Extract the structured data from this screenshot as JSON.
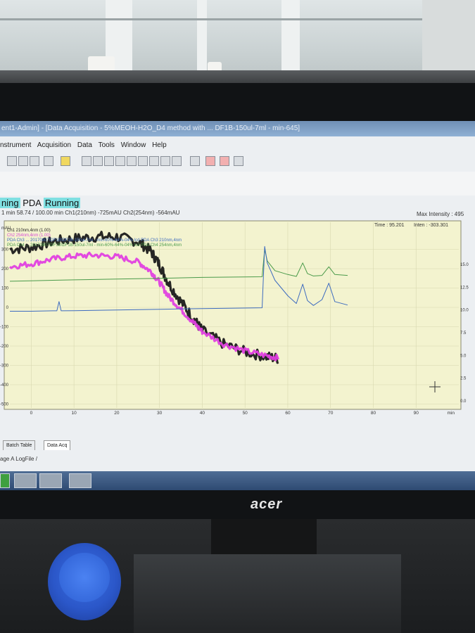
{
  "window": {
    "title": "ent1-Admin] - [Data Acquisition - 5%MEOH-H2O_D4 method with ... DF1B-150ul-7ml - min-645]"
  },
  "menu": [
    "nstrument",
    "Acquisition",
    "Data",
    "Tools",
    "Window",
    "Help"
  ],
  "status": {
    "prefix": "ning",
    "pda_label": "PDA",
    "running_label": "Running"
  },
  "info_line": "1 min 58.74 / 100.00 min Ch1(210nm) -725mAU Ch2(254nm) -564mAU",
  "max_intensity": "Max Intensity :    495",
  "time_readout": "Time : 95.201",
  "inten_readout": "Inten :    -303.301",
  "legend": [
    {
      "text": "Ch1 210nm,4nm (1.00)",
      "color": "#222222"
    },
    {
      "text": "Ch2 254nm,4nm (1.00)",
      "color": "#d94ad9"
    },
    {
      "text": "PDA Ch3 ... 20170807\\DF1B\\DF1B-150ul-7ml - min-60%-64%-04% lcd PDA Ch3 210nm,4nm",
      "color": "#3d6bbf"
    },
    {
      "text": "PDA Ch4 ... 20170807\\DF1B\\DF1B-150ul-7ml - min-60%-64%-04% lcd PDA Ch4 254nm,4nm",
      "color": "#4a9a4a"
    }
  ],
  "tabs": [
    "Batch Table",
    "Data Acq"
  ],
  "bottom_line": "age A LogFile /",
  "monitor_brand": "acer",
  "chart_data": {
    "type": "line",
    "xlabel": "min",
    "ylabel": "mAU",
    "x_ticks": [
      0,
      10,
      20,
      30,
      40,
      50,
      60,
      70,
      80,
      90
    ],
    "y_ticks": [
      -500,
      -400,
      -300,
      -200,
      -100,
      0,
      100,
      200,
      300
    ],
    "right_ticks": [
      "0.0",
      "2.5",
      "5.0",
      "7.5",
      "10.0",
      "12.5",
      "15.0"
    ],
    "xlim": [
      -5,
      100
    ],
    "ylim": [
      -520,
      440
    ],
    "series": [
      {
        "color": "#1a1a1a",
        "x": [
          -5,
          0,
          5,
          10,
          15,
          20,
          25,
          28,
          30,
          32,
          35,
          38,
          40,
          45,
          50,
          55,
          58
        ],
        "y": [
          300,
          310,
          340,
          355,
          365,
          365,
          340,
          290,
          220,
          130,
          30,
          -60,
          -120,
          -190,
          -230,
          -255,
          -265
        ]
      },
      {
        "color": "#e040e0",
        "x": [
          -5,
          0,
          5,
          10,
          15,
          20,
          25,
          28,
          30,
          32,
          35,
          38,
          40,
          45,
          50,
          55,
          58
        ],
        "y": [
          210,
          225,
          250,
          265,
          270,
          262,
          235,
          185,
          130,
          60,
          -10,
          -80,
          -125,
          -190,
          -225,
          -250,
          -262
        ]
      },
      {
        "color": "#4a9a4a",
        "x": [
          -5,
          0,
          5,
          10,
          20,
          30,
          40,
          54,
          54.6,
          55.2,
          57,
          60,
          62,
          63.5,
          64.6,
          66,
          68,
          69.6,
          71,
          74
        ],
        "y": [
          135,
          137,
          140,
          142,
          146,
          150,
          155,
          158,
          300,
          240,
          190,
          170,
          160,
          230,
          175,
          162,
          165,
          210,
          170,
          165
        ]
      },
      {
        "color": "#3d6bbf",
        "x": [
          -5,
          0,
          5,
          6,
          6.5,
          7,
          10,
          20,
          30,
          40,
          54,
          54.6,
          55.2,
          57,
          60,
          62,
          63.5,
          64.6,
          66,
          68,
          69.6,
          71,
          74
        ],
        "y": [
          -20,
          -20,
          -18,
          -18,
          30,
          -18,
          -17,
          -14,
          -10,
          -6,
          -2,
          315,
          230,
          140,
          60,
          20,
          120,
          35,
          10,
          40,
          125,
          30,
          12
        ]
      }
    ]
  }
}
